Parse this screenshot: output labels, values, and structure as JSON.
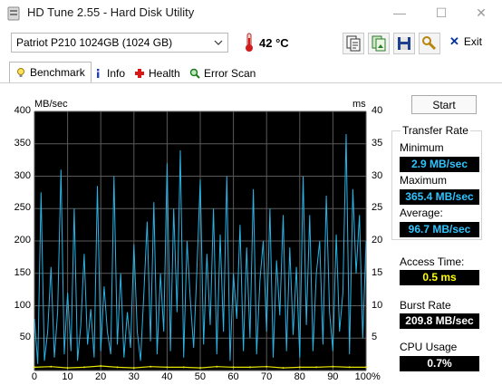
{
  "window": {
    "title": "HD Tune 2.55 - Hard Disk Utility",
    "minimize": "—",
    "maximize": "☐",
    "close": "✕"
  },
  "toolbar": {
    "drive": "Patriot P210 1024GB (1024 GB)",
    "temperature": "42 °C",
    "exit_label": "Exit"
  },
  "tabs": [
    {
      "label": "Benchmark",
      "icon": "bulb-icon",
      "active": true
    },
    {
      "label": "Info",
      "icon": "info-icon",
      "active": false
    },
    {
      "label": "Health",
      "icon": "health-cross-icon",
      "active": false
    },
    {
      "label": "Error Scan",
      "icon": "magnifier-icon",
      "active": false
    }
  ],
  "benchmark": {
    "start_label": "Start",
    "transfer_rate_title": "Transfer Rate",
    "minimum_label": "Minimum",
    "minimum_value": "2.9 MB/sec",
    "maximum_label": "Maximum",
    "maximum_value": "365.4 MB/sec",
    "average_label": "Average:",
    "average_value": "96.7 MB/sec",
    "access_time_label": "Access Time:",
    "access_time_value": "0.5 ms",
    "burst_rate_label": "Burst Rate",
    "burst_rate_value": "209.8 MB/sec",
    "cpu_usage_label": "CPU Usage",
    "cpu_usage_value": "0.7%"
  },
  "chart_data": {
    "type": "line",
    "title": "",
    "ylabel": "MB/sec",
    "y2label": "ms",
    "ylim": [
      0,
      400
    ],
    "y2lim": [
      0,
      40
    ],
    "yticks": [
      "400",
      "350",
      "300",
      "250",
      "200",
      "150",
      "100",
      "50"
    ],
    "y2ticks": [
      "40",
      "35",
      "30",
      "25",
      "20",
      "15",
      "10",
      "5"
    ],
    "xticks": [
      "0",
      "10",
      "20",
      "30",
      "40",
      "50",
      "60",
      "70",
      "80",
      "90",
      "100%"
    ],
    "xlim": [
      0,
      100
    ],
    "grid": true,
    "background": "#000000",
    "gridColor": "#5a5a5a",
    "series": [
      {
        "color": "#2ab4e6",
        "x": [
          0,
          1,
          2,
          3,
          4,
          5,
          6,
          7,
          8,
          9,
          10,
          11,
          12,
          13,
          14,
          15,
          16,
          17,
          18,
          19,
          20,
          21,
          22,
          23,
          24,
          25,
          26,
          27,
          28,
          29,
          30,
          31,
          32,
          33,
          34,
          35,
          36,
          37,
          38,
          39,
          40,
          41,
          42,
          43,
          44,
          45,
          46,
          47,
          48,
          49,
          50,
          51,
          52,
          53,
          54,
          55,
          56,
          57,
          58,
          59,
          60,
          61,
          62,
          63,
          64,
          65,
          66,
          67,
          68,
          69,
          70,
          71,
          72,
          73,
          74,
          75,
          76,
          77,
          78,
          79,
          80,
          81,
          82,
          83,
          84,
          85,
          86,
          87,
          88,
          89,
          90,
          91,
          92,
          93,
          94,
          95,
          96,
          97,
          98,
          99,
          100
        ],
        "values": [
          80,
          10,
          275,
          15,
          60,
          160,
          20,
          90,
          310,
          25,
          120,
          30,
          250,
          15,
          70,
          180,
          40,
          95,
          20,
          285,
          30,
          130,
          60,
          25,
          300,
          40,
          150,
          20,
          90,
          35,
          195,
          60,
          15,
          120,
          230,
          45,
          260,
          25,
          150,
          60,
          320,
          30,
          250,
          90,
          340,
          20,
          200,
          110,
          35,
          155,
          295,
          40,
          180,
          70,
          250,
          25,
          210,
          60,
          300,
          15,
          150,
          80,
          225,
          30,
          190,
          50,
          280,
          25,
          140,
          200,
          60,
          250,
          20,
          170,
          85,
          240,
          30,
          190,
          55,
          160,
          20,
          300,
          70,
          240,
          30,
          150,
          200,
          40,
          270,
          90,
          30,
          210,
          60,
          120,
          365,
          25,
          280,
          150,
          240,
          50,
          200
        ]
      },
      {
        "name": "Access Time",
        "color": "#e6e600",
        "x": [
          0,
          5,
          10,
          15,
          20,
          25,
          30,
          35,
          40,
          45,
          50,
          55,
          60,
          65,
          70,
          75,
          80,
          85,
          90,
          95,
          100
        ],
        "values": [
          0.5,
          0.6,
          0.4,
          0.5,
          0.7,
          0.5,
          0.4,
          0.6,
          0.5,
          0.5,
          0.4,
          0.6,
          0.5,
          0.5,
          0.6,
          0.4,
          0.5,
          0.5,
          0.6,
          0.5,
          0.5
        ]
      }
    ]
  }
}
